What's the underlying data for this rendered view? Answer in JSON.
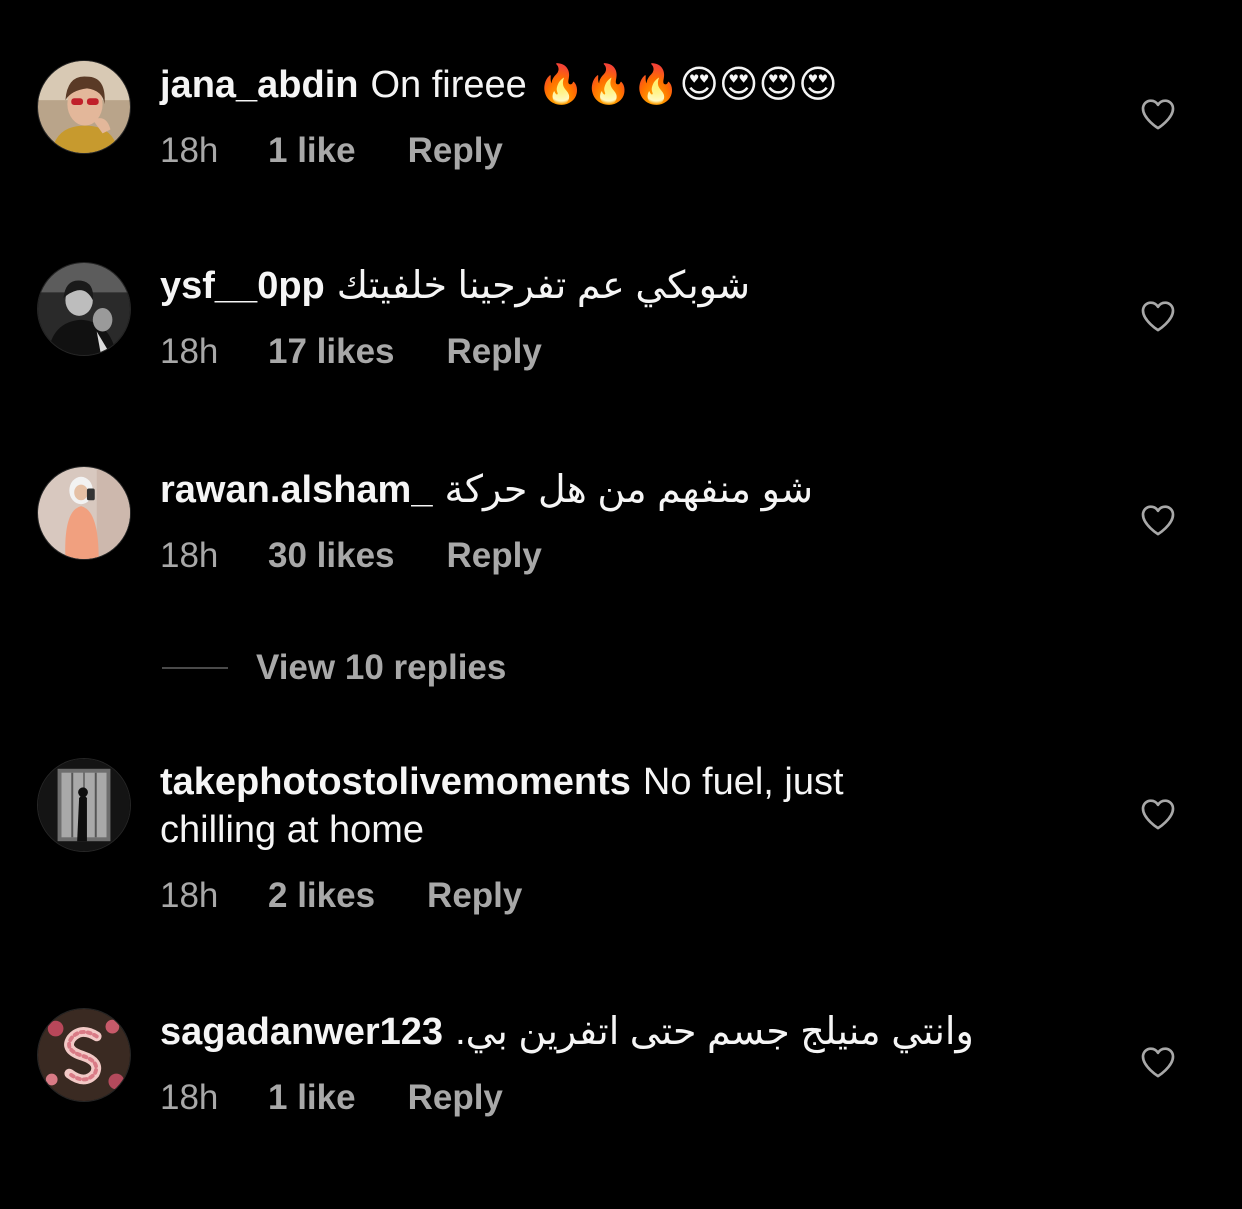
{
  "comments": [
    {
      "username": "jana_abdin",
      "text": "On fireee",
      "emojis": "🔥🔥🔥😍😍😍😍",
      "time": "18h",
      "likes": "1 like",
      "reply": "Reply",
      "avatar_icon": "avatar-girl-yellow-top"
    },
    {
      "username": "ysf__0pp",
      "text": "شوبكي عم تفرجينا خلفيتك",
      "time": "18h",
      "likes": "17 likes",
      "reply": "Reply",
      "avatar_icon": "avatar-bw-portrait"
    },
    {
      "username": "rawan.alsham_",
      "text": "شو منفهم من هل حركة",
      "time": "18h",
      "likes": "30 likes",
      "reply": "Reply",
      "avatar_icon": "avatar-hijab-pink"
    },
    {
      "username": "takephotostolivemoments",
      "text": "No fuel, just chilling at home",
      "time": "18h",
      "likes": "2 likes",
      "reply": "Reply",
      "avatar_icon": "avatar-window-silhouette"
    },
    {
      "username": "sagadanwer123",
      "text": "وانتي منيلج جسم حتى اتفرين بي.",
      "time": "18h",
      "likes": "1 like",
      "reply": "Reply",
      "avatar_icon": "avatar-letter-s-flowers"
    }
  ],
  "view_replies": "View 10 replies",
  "icons": {
    "like": "heart-outline-icon"
  },
  "colors": {
    "background": "#000000",
    "primary_text": "#f5f5f5",
    "secondary_text": "#a8a8a8"
  }
}
